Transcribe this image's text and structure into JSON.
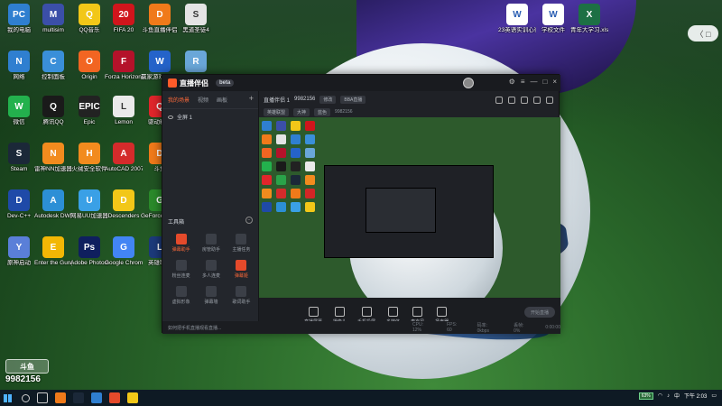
{
  "desktop": {
    "icons": [
      {
        "label": "我的电脑",
        "glyph": "PC",
        "color": "#2f7fd0"
      },
      {
        "label": "multisim",
        "glyph": "M",
        "color": "#3b4fa8"
      },
      {
        "label": "QQ音乐",
        "glyph": "Q",
        "color": "#f2c718"
      },
      {
        "label": "FIFA 20",
        "glyph": "20",
        "color": "#d0151c"
      },
      {
        "label": "斗鱼直播伴侣",
        "glyph": "D",
        "color": "#f07a1a"
      },
      {
        "label": "黑道圣徒4",
        "glyph": "S",
        "color": "#e4e4e4"
      },
      {
        "label": "网络",
        "glyph": "N",
        "color": "#2f7fd0"
      },
      {
        "label": "控制面板",
        "glyph": "C",
        "color": "#3a8fd9"
      },
      {
        "label": "Origin",
        "glyph": "O",
        "color": "#f26522"
      },
      {
        "label": "Forza Horizon 4",
        "glyph": "F",
        "color": "#b4122a"
      },
      {
        "label": "赢家游戏 2077",
        "glyph": "W",
        "color": "#2563c9"
      },
      {
        "label": "回收站",
        "glyph": "R",
        "color": "#6aa7d9"
      },
      {
        "label": "微信",
        "glyph": "W",
        "color": "#23b14d"
      },
      {
        "label": "腾讯QQ",
        "glyph": "Q",
        "color": "#1a1a1a"
      },
      {
        "label": "Epic",
        "glyph": "EPIC",
        "color": "#222222"
      },
      {
        "label": "Lemon",
        "glyph": "L",
        "color": "#eaeaea"
      },
      {
        "label": "驱动精灵",
        "glyph": "Q",
        "color": "#e0262b"
      },
      {
        "label": "联想软件商店",
        "glyph": "L",
        "color": "#2aa349"
      },
      {
        "label": "Steam",
        "glyph": "S",
        "color": "#1b2838"
      },
      {
        "label": "雷神NN加速器",
        "glyph": "N",
        "color": "#f28b1e"
      },
      {
        "label": "火绒安全软件",
        "glyph": "H",
        "color": "#f28b1e"
      },
      {
        "label": "AutoCAD 2007 - 简体",
        "glyph": "A",
        "color": "#d42b2b"
      },
      {
        "label": "斗鱼",
        "glyph": "D",
        "color": "#f07a1a"
      },
      {
        "label": "Among Us",
        "glyph": "A",
        "color": "#d32626"
      },
      {
        "label": "Dev-C++",
        "glyph": "D",
        "color": "#1f4aa8"
      },
      {
        "label": "Autodesk DWF View",
        "glyph": "A",
        "color": "#2c8fd6"
      },
      {
        "label": "网易UU加速器",
        "glyph": "U",
        "color": "#3aa0e6"
      },
      {
        "label": "Descenders",
        "glyph": "D",
        "color": "#f2c718"
      },
      {
        "label": "GeForce Experience",
        "glyph": "G",
        "color": "#2b8a2b"
      },
      {
        "label": "Rockstar Games ...",
        "glyph": "R",
        "color": "#f2b705"
      },
      {
        "label": "原神启动",
        "glyph": "Y",
        "color": "#5a7fd8"
      },
      {
        "label": "Enter the Gungeon",
        "glyph": "E",
        "color": "#f2b705"
      },
      {
        "label": "Adobe Photoshop",
        "glyph": "Ps",
        "color": "#0f1f5e"
      },
      {
        "label": "Google Chrome",
        "glyph": "G",
        "color": "#4285f4"
      },
      {
        "label": "英雄联盟",
        "glyph": "L",
        "color": "#1c3a7a"
      },
      {
        "label": "Draw & Guess",
        "glyph": "D",
        "color": "#e0e0e0"
      }
    ],
    "right_icons": [
      {
        "label": "23英语实训心得",
        "glyph": "W",
        "color": "#ffffff"
      },
      {
        "label": "学校文件",
        "glyph": "W",
        "color": "#ffffff"
      },
      {
        "label": "青年大学习.xlsx",
        "glyph": "X",
        "color": "#1d7044"
      }
    ],
    "side_pill": "〈 □",
    "watermark": {
      "logo": "斗鱼",
      "room_id": "9982156"
    }
  },
  "app": {
    "brand": "直播伴侣",
    "version": "beta",
    "left_tabs": [
      "我的场景",
      "视频",
      "画板"
    ],
    "left_tab_add": "+",
    "scene_name": "全屏 1",
    "tools_title": "工具箱",
    "tools": [
      {
        "label": "弹幕助手",
        "hot": true
      },
      {
        "label": "房管助手",
        "hot": false
      },
      {
        "label": "主播任务",
        "hot": false
      },
      {
        "label": "粉丝连麦",
        "hot": false
      },
      {
        "label": "多人连麦",
        "hot": false
      },
      {
        "label": "弹幕姬",
        "hot": true
      },
      {
        "label": "虚拟形象",
        "hot": false
      },
      {
        "label": "弹幕墙",
        "hot": false
      },
      {
        "label": "歌词助手",
        "hot": false
      }
    ],
    "footer_notice": "如何把手机直播观看直播...",
    "info": {
      "title": "直播伴侣 1",
      "room_id": "9982156",
      "pill1": "修改",
      "pill2": "BBA直播",
      "tags": [
        "英雄联盟",
        "大神",
        "蓝色",
        "9982156"
      ]
    },
    "controls": [
      "直播屏幕",
      "摄像头",
      "手机投屏",
      "多媒体",
      "麦克风",
      "扬声器"
    ],
    "start_label": "开始直播",
    "status": [
      "CPU: 12%",
      "FPS: 60",
      "码率: 0kbps",
      "丢帧: 0%",
      "0:00:00"
    ]
  },
  "taskbar": {
    "tray_battery": "63%",
    "tray_ime": "中",
    "time": "下午 2:03"
  }
}
